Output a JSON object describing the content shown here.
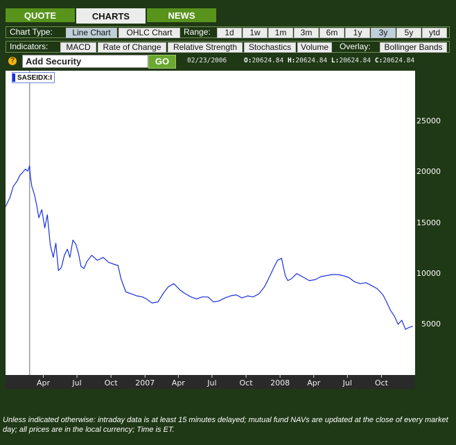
{
  "tabs": [
    {
      "label": "QUOTE",
      "active": false
    },
    {
      "label": "CHARTS",
      "active": true
    },
    {
      "label": "NEWS",
      "active": false
    }
  ],
  "chart_type": {
    "label": "Chart Type:",
    "options": [
      "Line Chart",
      "OHLC Chart"
    ],
    "selected": "Line Chart"
  },
  "range": {
    "label": "Range:",
    "options": [
      "1d",
      "1w",
      "1m",
      "3m",
      "6m",
      "1y",
      "3y",
      "5y",
      "ytd"
    ],
    "selected": "3y"
  },
  "indicators": {
    "label": "Indicators:",
    "options": [
      "MACD",
      "Rate of Change",
      "Relative Strength",
      "Stochastics",
      "Volume"
    ]
  },
  "overlay": {
    "label": "Overlay:",
    "options": [
      "Bollinger Bands"
    ]
  },
  "search": {
    "help_label": "?",
    "value": "Add Security",
    "go_label": "GO"
  },
  "quote_info": {
    "date": "02/23/2006",
    "open_label": "O:",
    "open": "20624.84",
    "high_label": "H:",
    "high": "20624.84",
    "low_label": "L:",
    "low": "20624.84",
    "close_label": "C:",
    "close": "20624.84"
  },
  "legend": {
    "symbol": "SASEIDX:I",
    "color": "#1a2fe0"
  },
  "disclaimer": "Unless indicated otherwise: intraday data is at least 15 minutes delayed; mutual fund NAVs are updated at the close of every market day; all prices are in the local currency; Time is ET.",
  "chart_data": {
    "type": "line",
    "series": [
      {
        "name": "SASEIDX:I",
        "color": "#1a2fe0",
        "x": [
          "2005-12-20",
          "2006-01-01",
          "2006-01-10",
          "2006-01-20",
          "2006-01-28",
          "2006-02-05",
          "2006-02-12",
          "2006-02-18",
          "2006-02-23",
          "2006-02-25",
          "2006-03-01",
          "2006-03-08",
          "2006-03-14",
          "2006-03-20",
          "2006-03-28",
          "2006-04-05",
          "2006-04-12",
          "2006-04-20",
          "2006-04-28",
          "2006-05-05",
          "2006-05-12",
          "2006-05-20",
          "2006-05-28",
          "2006-06-05",
          "2006-06-12",
          "2006-06-20",
          "2006-06-28",
          "2006-07-05",
          "2006-07-12",
          "2006-07-20",
          "2006-07-28",
          "2006-08-10",
          "2006-08-25",
          "2006-09-10",
          "2006-09-25",
          "2006-10-10",
          "2006-10-20",
          "2006-10-28",
          "2006-11-10",
          "2006-11-25",
          "2006-12-10",
          "2006-12-25",
          "2007-01-05",
          "2007-01-20",
          "2007-02-05",
          "2007-02-20",
          "2007-03-05",
          "2007-03-20",
          "2007-04-05",
          "2007-04-20",
          "2007-05-05",
          "2007-05-20",
          "2007-06-05",
          "2007-06-20",
          "2007-07-05",
          "2007-07-20",
          "2007-08-05",
          "2007-08-20",
          "2007-09-05",
          "2007-09-20",
          "2007-10-05",
          "2007-10-20",
          "2007-11-05",
          "2007-11-20",
          "2007-12-05",
          "2007-12-15",
          "2007-12-25",
          "2008-01-05",
          "2008-01-15",
          "2008-01-22",
          "2008-02-01",
          "2008-02-15",
          "2008-03-01",
          "2008-03-20",
          "2008-04-05",
          "2008-04-20",
          "2008-05-05",
          "2008-05-20",
          "2008-06-05",
          "2008-06-20",
          "2008-07-05",
          "2008-07-20",
          "2008-08-05",
          "2008-08-20",
          "2008-09-05",
          "2008-09-20",
          "2008-10-05",
          "2008-10-15",
          "2008-10-25",
          "2008-11-05",
          "2008-11-15",
          "2008-11-25",
          "2008-12-05",
          "2008-12-15",
          "2008-12-25"
        ],
        "values": [
          16600,
          17500,
          18600,
          19100,
          19700,
          20000,
          20300,
          20100,
          20625,
          19600,
          18600,
          17800,
          16800,
          15500,
          16300,
          14500,
          15800,
          12800,
          11600,
          13000,
          10300,
          10600,
          11800,
          12400,
          11600,
          13300,
          12900,
          12000,
          10700,
          10500,
          11200,
          11800,
          11300,
          11600,
          11100,
          10900,
          10800,
          9500,
          8200,
          8000,
          7800,
          7700,
          7500,
          7100,
          7200,
          8100,
          8700,
          9000,
          8400,
          8000,
          7700,
          7500,
          7700,
          7700,
          7200,
          7300,
          7600,
          7800,
          7900,
          7600,
          7800,
          7700,
          8000,
          8700,
          9800,
          10600,
          11300,
          11500,
          9800,
          9300,
          9500,
          10000,
          9700,
          9300,
          9400,
          9700,
          9800,
          9900,
          9900,
          9800,
          9600,
          9200,
          9000,
          9100,
          8800,
          8500,
          7900,
          7200,
          6400,
          5800,
          5000,
          5400,
          4500,
          4700,
          4800
        ]
      }
    ],
    "xticks": [
      "Apr",
      "Jul",
      "Oct",
      "2007",
      "Apr",
      "Jul",
      "Oct",
      "2008",
      "Apr",
      "Jul",
      "Oct"
    ],
    "yticks": [
      5000,
      10000,
      15000,
      20000,
      25000
    ],
    "ylim": [
      0,
      30000
    ],
    "cursor_date": "02/23/2006",
    "grid": false
  }
}
